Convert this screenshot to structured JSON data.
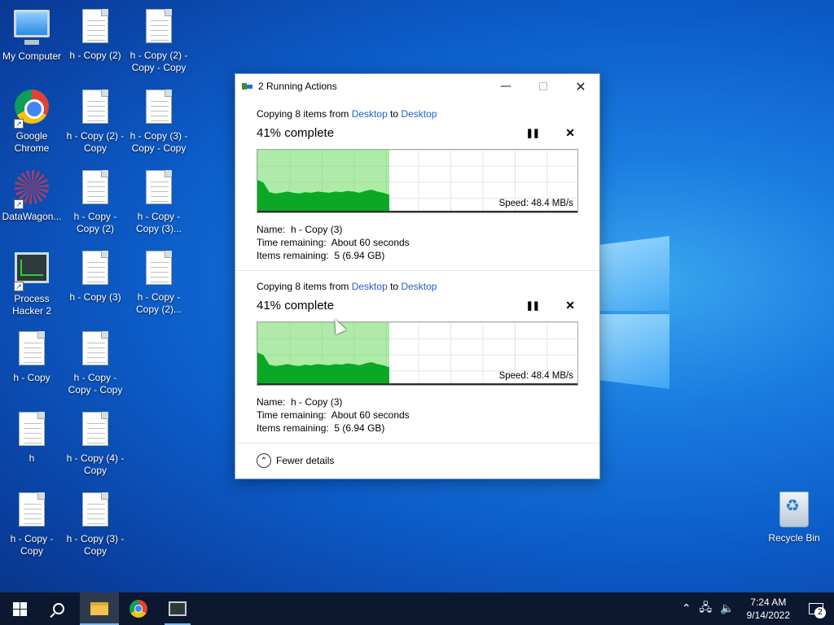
{
  "desktop": {
    "icons": [
      {
        "label": "My Computer",
        "kind": "computer-icon"
      },
      {
        "label": "h - Copy (2)",
        "kind": "document-icon"
      },
      {
        "label": "h - Copy (2) - Copy - Copy",
        "kind": "document-icon"
      },
      {
        "label": "Google Chrome",
        "kind": "chrome-icon"
      },
      {
        "label": "h - Copy (2) - Copy",
        "kind": "document-icon"
      },
      {
        "label": "h - Copy (3) - Copy - Copy",
        "kind": "document-icon"
      },
      {
        "label": "DataWagon...",
        "kind": "datawagon-icon"
      },
      {
        "label": "h - Copy - Copy (2)",
        "kind": "document-icon"
      },
      {
        "label": "h - Copy - Copy (3)...",
        "kind": "document-icon"
      },
      {
        "label": "Process Hacker 2",
        "kind": "process-hacker-icon"
      },
      {
        "label": "h - Copy (3)",
        "kind": "document-icon"
      },
      {
        "label": "h - Copy - Copy (2)...",
        "kind": "document-icon"
      },
      {
        "label": "h - Copy",
        "kind": "document-icon"
      },
      {
        "label": "h - Copy - Copy - Copy",
        "kind": "document-icon"
      },
      {
        "label": "h",
        "kind": "document-icon"
      },
      {
        "label": "h - Copy (4) - Copy",
        "kind": "document-icon"
      },
      {
        "label": "h - Copy - Copy",
        "kind": "document-icon"
      },
      {
        "label": "h - Copy (3) - Copy",
        "kind": "document-icon"
      },
      {
        "label": "Recycle Bin",
        "kind": "recycle-bin-icon"
      }
    ]
  },
  "dialog": {
    "title": "2 Running Actions",
    "operations": [
      {
        "header_prefix": "Copying 8 items from ",
        "source": "Desktop",
        "to_text": " to ",
        "destination": "Desktop",
        "percent_text": "41% complete",
        "progress_fraction": 0.41,
        "speed": "Speed: 48.4 MB/s",
        "name_label": "Name:",
        "name_value": "h - Copy (3)",
        "time_label": "Time remaining:",
        "time_value": "About 60 seconds",
        "items_label": "Items remaining:",
        "items_value": "5 (6.94 GB)"
      },
      {
        "header_prefix": "Copying 8 items from ",
        "source": "Desktop",
        "to_text": " to ",
        "destination": "Desktop",
        "percent_text": "41% complete",
        "progress_fraction": 0.41,
        "speed": "Speed: 48.4 MB/s",
        "name_label": "Name:",
        "name_value": "h - Copy (3)",
        "time_label": "Time remaining:",
        "time_value": "About 60 seconds",
        "items_label": "Items remaining:",
        "items_value": "5 (6.94 GB)"
      }
    ],
    "fewer_details": "Fewer details"
  },
  "taskbar": {
    "clock_time": "7:24 AM",
    "clock_date": "9/14/2022",
    "notification_count": "2"
  },
  "colors": {
    "link": "#1f5fbf",
    "progress_fill": "#78dc6e",
    "graph_area": "#0aa825"
  }
}
